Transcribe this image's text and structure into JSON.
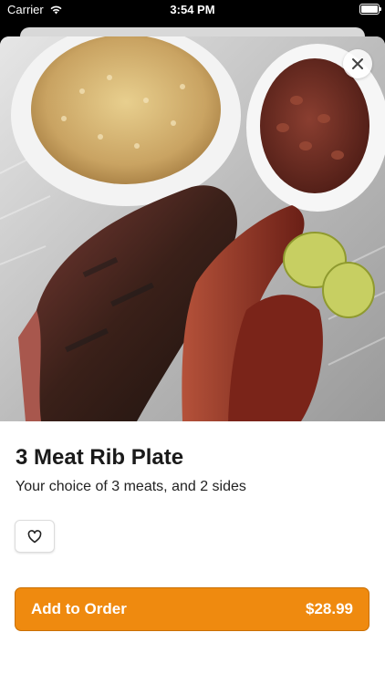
{
  "status_bar": {
    "carrier": "Carrier",
    "time": "3:54 PM"
  },
  "item": {
    "title": "3 Meat Rib Plate",
    "description": "Your choice of 3 meats, and 2 sides",
    "image_alt": "Photo of brisket, ribs, rice, beans and pickles"
  },
  "footer": {
    "add_label": "Add to Order",
    "price": "$28.99"
  },
  "colors": {
    "accent": "#ef8a0f"
  },
  "icons": {
    "close": "close-icon",
    "favorite": "heart-icon",
    "wifi": "wifi-icon"
  }
}
